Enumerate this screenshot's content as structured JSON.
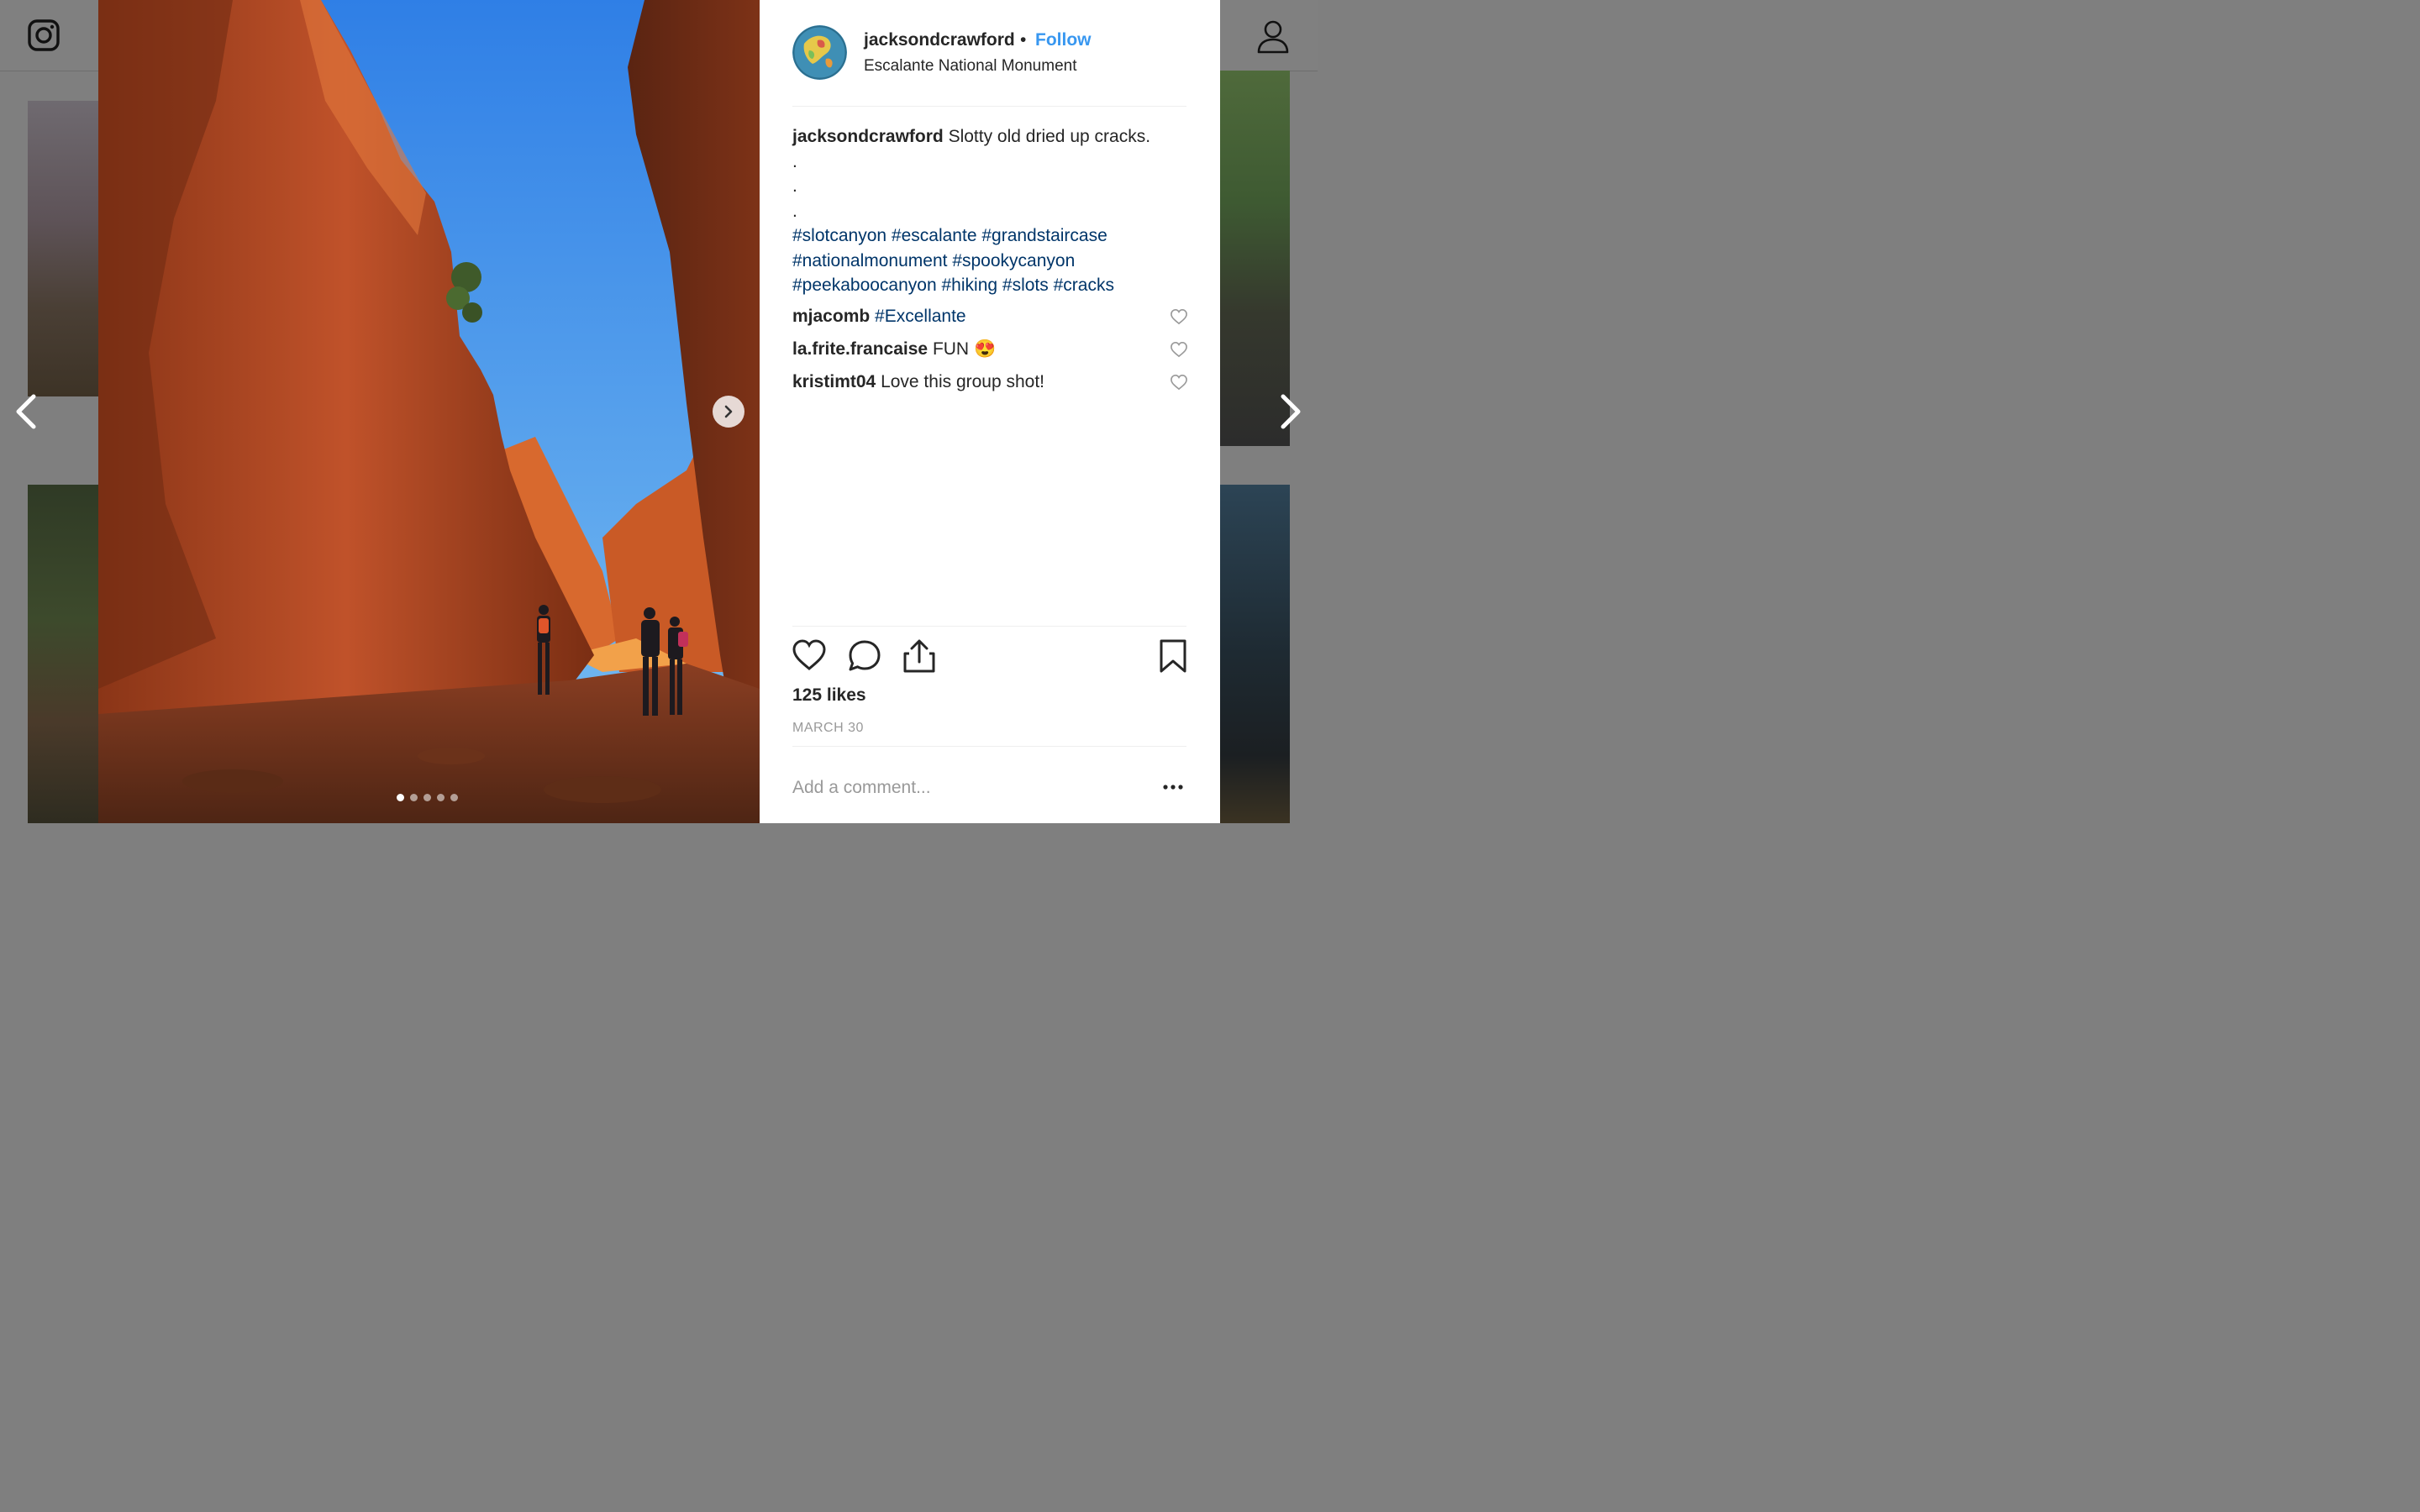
{
  "post": {
    "username": "jacksondcrawford",
    "bullet": "•",
    "follow_label": "Follow",
    "location": "Escalante National Monument",
    "caption_user": "jacksondcrawford",
    "caption_text": "Slotty old dried up cracks.",
    "caption_dots": [
      ".",
      ".",
      "."
    ],
    "hashtags": [
      "#slotcanyon",
      "#escalante",
      "#grandstaircase",
      "#nationalmonument",
      "#spookycanyon",
      "#peekaboocanyon",
      "#hiking",
      "#slots",
      "#cracks"
    ],
    "comments": [
      {
        "user": "mjacomb",
        "text": "#Excellante",
        "is_tag": true,
        "emoji": ""
      },
      {
        "user": "la.frite.francaise",
        "text": "FUN",
        "is_tag": false,
        "emoji": "😍"
      },
      {
        "user": "kristimt04",
        "text": "Love this group shot!",
        "is_tag": false,
        "emoji": ""
      }
    ],
    "likes": "125 likes",
    "date": "MARCH 30",
    "comment_placeholder": "Add a comment...",
    "carousel": {
      "count": 5,
      "active": 0
    }
  },
  "icons": {
    "header": [
      "instagram-icon",
      "profile-icon"
    ],
    "actions": [
      "heart-icon",
      "comment-icon",
      "share-icon",
      "bookmark-icon"
    ],
    "navigation": [
      "chevron-left-icon",
      "chevron-right-icon"
    ]
  },
  "colors": {
    "link_blue": "#3897f0",
    "hashtag": "#003569",
    "text": "#262626",
    "muted": "#999999",
    "sky": "#3d8fe6",
    "rock": "#c4562a"
  }
}
